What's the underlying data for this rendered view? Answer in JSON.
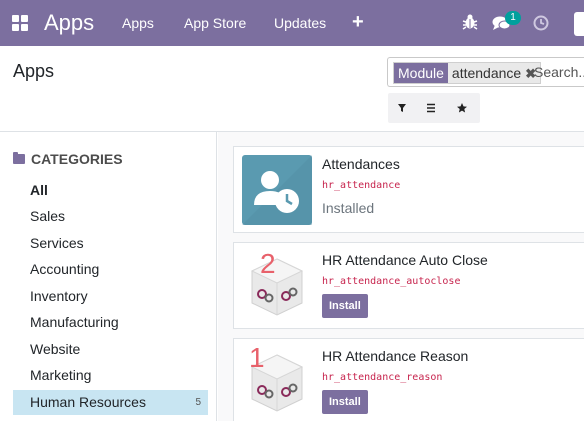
{
  "navbar": {
    "brand": "Apps",
    "menu": [
      "Apps",
      "App Store",
      "Updates"
    ],
    "plus_icon": "plus-icon",
    "icons": [
      "bug-icon",
      "chat-icon",
      "clock-icon"
    ],
    "chat_badge": "1",
    "color": "#7c6f9f"
  },
  "control_panel": {
    "title": "Apps",
    "search": {
      "facet_label": "Module",
      "facet_value": "attendance",
      "facet_remove_icon": "close-icon",
      "placeholder": "Search..."
    },
    "buttons": [
      "filter-icon",
      "group-by-icon",
      "favorite-icon"
    ]
  },
  "sidebar": {
    "heading": "CATEGORIES",
    "heading_icon": "folder-icon",
    "items": [
      {
        "label": "All",
        "active": false
      },
      {
        "label": "Sales"
      },
      {
        "label": "Services"
      },
      {
        "label": "Accounting"
      },
      {
        "label": "Inventory"
      },
      {
        "label": "Manufacturing"
      },
      {
        "label": "Website"
      },
      {
        "label": "Marketing"
      },
      {
        "label": "Human Resources",
        "count": "5",
        "active": true
      }
    ]
  },
  "apps": [
    {
      "name": "Attendances",
      "technical_name": "hr_attendance",
      "status": "Installed",
      "icon": "attendance-app-icon"
    },
    {
      "name": "HR Attendance Auto Close",
      "technical_name": "hr_attendance_autoclose",
      "action": "Install",
      "icon": "oca-module-icon",
      "annotation": "2"
    },
    {
      "name": "HR Attendance Reason",
      "technical_name": "hr_attendance_reason",
      "action": "Install",
      "icon": "oca-module-icon",
      "annotation": "1"
    }
  ],
  "colors": {
    "accent": "#7c6f9f",
    "active_category": "#c8e5f2",
    "technical_name": "#c7254e",
    "annotation": "#e8616b",
    "attendance_tile": "#5a9ab0"
  }
}
